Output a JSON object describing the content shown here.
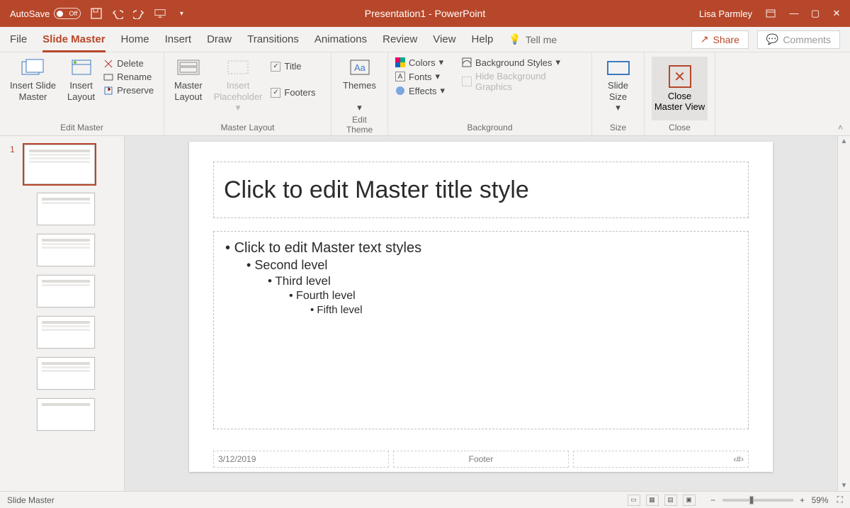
{
  "titlebar": {
    "autosave_label": "AutoSave",
    "autosave_state": "Off",
    "doc_title": "Presentation1  -  PowerPoint",
    "user": "Lisa Parmley"
  },
  "tabs": {
    "items": [
      "File",
      "Slide Master",
      "Home",
      "Insert",
      "Draw",
      "Transitions",
      "Animations",
      "Review",
      "View",
      "Help"
    ],
    "active_index": 1,
    "tell_me": "Tell me",
    "share": "Share",
    "comments": "Comments"
  },
  "ribbon": {
    "edit_master": {
      "insert_slide_master": "Insert Slide\nMaster",
      "insert_layout": "Insert\nLayout",
      "delete": "Delete",
      "rename": "Rename",
      "preserve": "Preserve",
      "group": "Edit Master"
    },
    "master_layout": {
      "master_layout": "Master\nLayout",
      "insert_placeholder": "Insert\nPlaceholder",
      "chk_title": "Title",
      "chk_footers": "Footers",
      "group": "Master Layout"
    },
    "edit_theme": {
      "themes": "Themes",
      "group": "Edit Theme"
    },
    "background": {
      "colors": "Colors",
      "fonts": "Fonts",
      "effects": "Effects",
      "bg_styles": "Background Styles",
      "hide_bg": "Hide Background Graphics",
      "group": "Background"
    },
    "size": {
      "slide_size": "Slide\nSize",
      "group": "Size"
    },
    "close": {
      "close_master": "Close\nMaster View",
      "group": "Close"
    }
  },
  "slide": {
    "title_ph": "Click to edit Master title style",
    "body": {
      "l1": "Click to edit Master text styles",
      "l2": "Second level",
      "l3": "Third level",
      "l4": "Fourth level",
      "l5": "Fifth level"
    },
    "footer_date": "3/12/2019",
    "footer_text": "Footer",
    "footer_num": "‹#›"
  },
  "thumbs": {
    "selected_index": 1
  },
  "status": {
    "mode": "Slide Master",
    "zoom": "59%"
  }
}
